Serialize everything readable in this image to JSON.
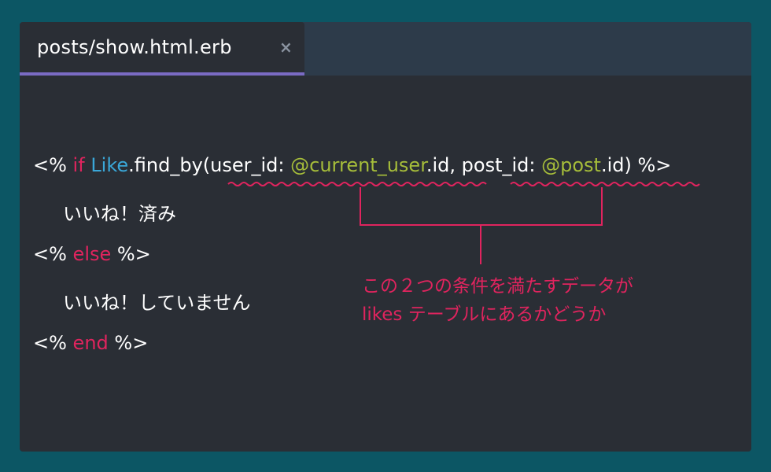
{
  "tab": {
    "title": "posts/show.html.erb",
    "close_glyph": "×"
  },
  "code": {
    "line1": {
      "open": "<% ",
      "kw_if": "if",
      "space1": " ",
      "class_name": "Like",
      "method": ".find_by(user_id: ",
      "ivar_current_user": "@current_user",
      "mid": ".id, post_id: ",
      "ivar_post": "@post",
      "close": ".id) %>"
    },
    "line2": "いいね！済み",
    "line3": {
      "open": "<% ",
      "kw_else": "else",
      "close": " %>"
    },
    "line4": "いいね！していません",
    "line5": {
      "open": "<% ",
      "kw_end": "end",
      "close": " %>"
    }
  },
  "annotation": {
    "line1": "この２つの条件を満たすデータが",
    "line2": "likes テーブルにあるかどうか"
  },
  "colors": {
    "background": "#0c5664",
    "editor": "#2a2e35",
    "tabbar": "#2d3b4a",
    "tab_underline": "#7a6bc4",
    "keyword": "#e0245e",
    "class": "#3aa7d8",
    "instance_var": "#a6bd3a",
    "annotation": "#e0245e"
  }
}
